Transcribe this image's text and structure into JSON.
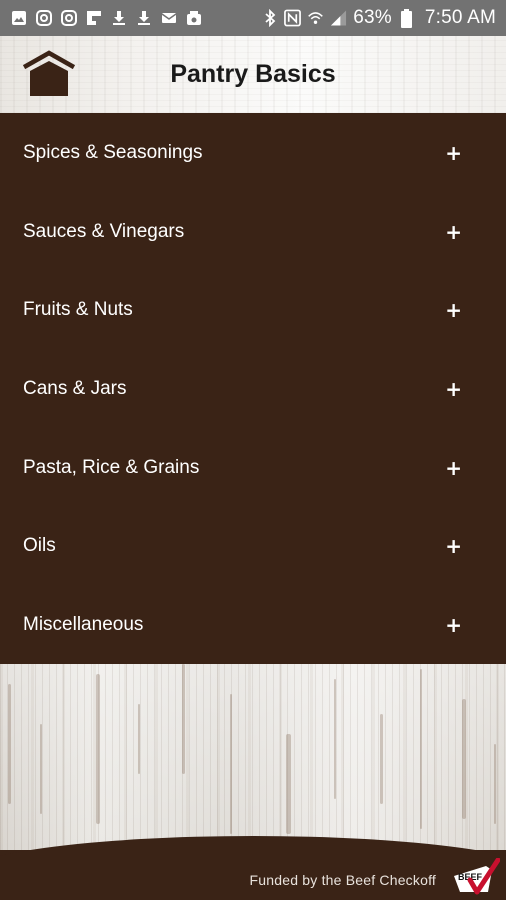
{
  "status_bar": {
    "battery_percent": "63%",
    "time": "7:50 AM",
    "icons": [
      "image-icon",
      "instagram-icon",
      "instagram-icon",
      "flipboard-icon",
      "download-icon",
      "download-icon",
      "mail-icon",
      "photo-icon",
      "bluetooth-icon",
      "nfc-icon",
      "wifi-icon",
      "signal-icon",
      "battery-icon"
    ]
  },
  "header": {
    "title": "Pantry Basics",
    "home_icon": "home-icon"
  },
  "menu": {
    "items": [
      {
        "label": "Spices & Seasonings",
        "icon": "+"
      },
      {
        "label": "Sauces & Vinegars",
        "icon": "+"
      },
      {
        "label": "Fruits & Nuts",
        "icon": "+"
      },
      {
        "label": "Cans & Jars",
        "icon": "+"
      },
      {
        "label": "Pasta, Rice & Grains",
        "icon": "+"
      },
      {
        "label": "Oils",
        "icon": "+"
      },
      {
        "label": "Miscellaneous",
        "icon": "+"
      }
    ]
  },
  "footer": {
    "funded_text": "Funded by the Beef Checkoff",
    "logo_text": "BEEF"
  },
  "colors": {
    "menu_background": "#3a2316",
    "status_bar": "#727272",
    "logo_red": "#c8102e"
  }
}
